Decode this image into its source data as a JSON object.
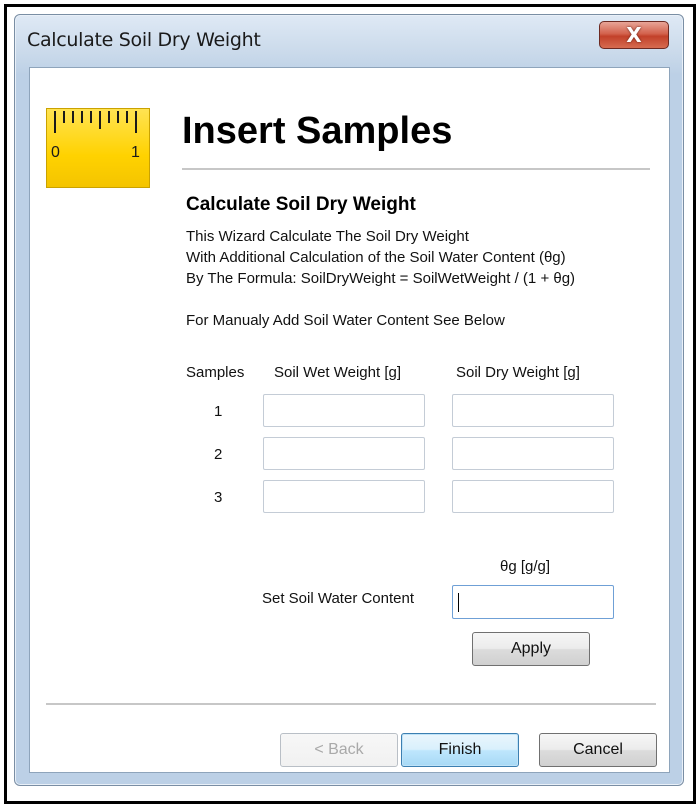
{
  "window": {
    "title": "Calculate Soil Dry Weight",
    "close_glyph": "X"
  },
  "icon": {
    "name": "ruler-icon",
    "labels": [
      "0",
      "1"
    ]
  },
  "page": {
    "heading": "Insert Samples",
    "subheading": "Calculate Soil Dry Weight",
    "description": [
      "This Wizard Calculate The Soil Dry Weight",
      "With Additional Calculation of the Soil Water Content (θg)",
      "By The Formula: SoilDryWeight = SoilWetWeight / (1 + θg)",
      "For Manualy Add Soil Water Content See Below"
    ]
  },
  "table": {
    "headers": [
      "Samples",
      "Soil Wet Weight [g]",
      "Soil Dry Weight [g]"
    ],
    "rows": [
      {
        "label": "1",
        "wet": "",
        "dry": ""
      },
      {
        "label": "2",
        "wet": "",
        "dry": ""
      },
      {
        "label": "3",
        "wet": "",
        "dry": ""
      }
    ]
  },
  "water_content": {
    "unit_label": "θg [g/g]",
    "label": "Set Soil Water Content",
    "value": ""
  },
  "buttons": {
    "apply": "Apply",
    "back": "< Back",
    "finish": "Finish",
    "cancel": "Cancel"
  },
  "colors": {
    "icon_yellow": "#ffd200",
    "default_button_border": "#3c7fb1",
    "close_red": "#c2412a"
  }
}
